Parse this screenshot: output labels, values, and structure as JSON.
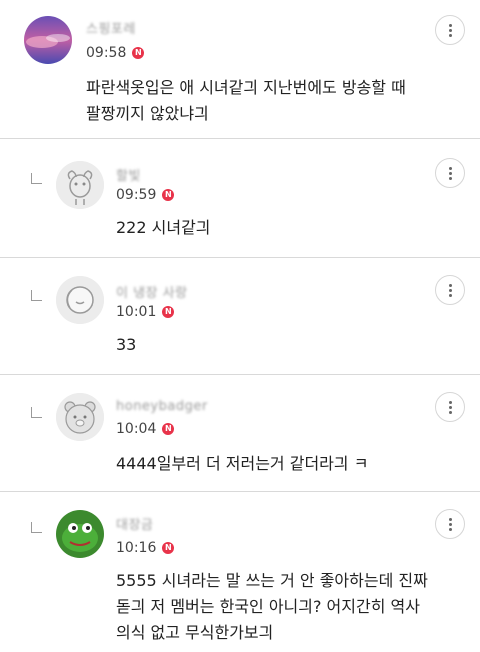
{
  "comments": [
    {
      "nickname": "스핑포레",
      "time": "09:58",
      "badge": "N",
      "text": "파란색옷입은 애 시녀같긔 지난번에도 방송할 때\n팔짱끼지 않았냐긔",
      "avatar": "sky-sunset-photo",
      "is_reply": false
    },
    {
      "nickname": "할빛",
      "time": "09:59",
      "badge": "N",
      "text": "222 시녀같긔",
      "avatar": "default-dog-avatar",
      "is_reply": true
    },
    {
      "nickname": "이 냉장 사랑",
      "time": "10:01",
      "badge": "N",
      "text": "33",
      "avatar": "default-round-avatar",
      "is_reply": true
    },
    {
      "nickname": "honeybadger",
      "time": "10:04",
      "badge": "N",
      "text": "4444일부러 더 저러는거 같더라긔 ㅋ",
      "avatar": "default-bear-avatar",
      "is_reply": true
    },
    {
      "nickname": "대장금",
      "time": "10:16",
      "badge": "N",
      "text": "5555 시녀라는 말 쓰는 거 안 좋아하는데 진짜\n돋긔 저 멤버는 한국인 아니긔? 어지간히 역사\n의식 없고 무식한가보긔",
      "avatar": "green-frog-avatar",
      "is_reply": true
    }
  ],
  "colors": {
    "badge": "#e8334a",
    "divider": "#d9d9d9",
    "text": "#222222",
    "meta": "#444444"
  }
}
